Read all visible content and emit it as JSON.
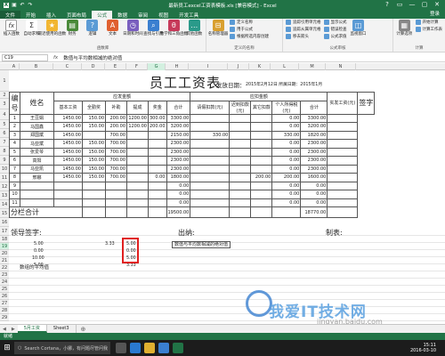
{
  "window": {
    "title": "最新员工excel工资表模板.xls [兼容模式] - Excel",
    "controls": [
      "?",
      "▭",
      "—",
      "▢",
      "✕"
    ]
  },
  "ribbon": {
    "tabs": [
      "文件",
      "开始",
      "插入",
      "页面布局",
      "公式",
      "数据",
      "审阅",
      "视图",
      "开发工具"
    ],
    "active_tab": "公式",
    "login": "登录",
    "groups": [
      {
        "name": "函数库",
        "buttons": [
          "插入函数",
          "自动求和",
          "最近使用的函数",
          "财务",
          "逻辑",
          "文本",
          "日期和时间",
          "查找与引用",
          "数学和三角函数",
          "其他函数"
        ]
      },
      {
        "name": "定义的名称",
        "buttons": [
          "名称管理器"
        ],
        "small": [
          "定义名称",
          "用于公式",
          "根据所选内容创建"
        ]
      },
      {
        "name": "公式审核",
        "small": [
          "追踪引用单元格",
          "追踪从属单元格",
          "移去箭头",
          "显示公式",
          "错误检查",
          "公式求值"
        ],
        "buttons": [
          "监视窗口"
        ]
      },
      {
        "name": "计算",
        "buttons": [
          "计算选项"
        ],
        "small": [
          "开始计算",
          "计算工作表"
        ]
      }
    ]
  },
  "formula_bar": {
    "name_box": "C19",
    "fx": "fx",
    "content": "数值与平均数相减的绝对值"
  },
  "columns": [
    "A",
    "B",
    "C",
    "D",
    "E",
    "F",
    "G",
    "H",
    "I",
    "J",
    "K",
    "L",
    "M",
    "N"
  ],
  "rows": [
    "1",
    "2",
    "3",
    "4",
    "5",
    "6",
    "7",
    "8",
    "9",
    "10",
    "11",
    "12",
    "13",
    "14",
    "15",
    "16",
    "17",
    "18",
    "19",
    "20",
    "21",
    "22",
    "23",
    "24",
    "25",
    "26",
    "27",
    "28",
    "29"
  ],
  "sheet": {
    "title": "员工工资表",
    "issue_label": "发放日期：",
    "issue_info": "2015年2月12日 所属日期：2015年1月",
    "header": {
      "no": "编号",
      "name": "姓名",
      "payable": "应发金额",
      "deduct": "应扣金额",
      "net": "实发工资(元)",
      "sign": "签字",
      "payable_cols": [
        "基本工资",
        "全勤奖",
        "补助",
        "提成",
        "奖金",
        "合计"
      ],
      "deduct_cols": [
        "请假扣款(元)",
        "迟到扣款(元)",
        "其它扣款",
        "个人所得税(元)",
        "合计"
      ]
    },
    "employees": [
      {
        "no": "1",
        "name": "王豆娟",
        "base": "1450.00",
        "full": "150.00",
        "sub": "200.00",
        "comm": "1200.00",
        "bonus": "300.00",
        "total": "3300.00",
        "leave": "",
        "late": "",
        "other": "",
        "tax": "",
        "dtotal": "0.00",
        "net": "3300.00"
      },
      {
        "no": "2",
        "name": "马国鑫",
        "base": "1450.00",
        "full": "150.00",
        "sub": "200.00",
        "comm": "1200.00",
        "bonus": "200.00",
        "total": "3200.00",
        "leave": "",
        "late": "",
        "other": "",
        "tax": "",
        "dtotal": "0.00",
        "net": "3200.00"
      },
      {
        "no": "3",
        "name": "郑国斌",
        "base": "1450.00",
        "full": "",
        "sub": "700.00",
        "comm": "",
        "bonus": "",
        "total": "2150.00",
        "leave": "330.00",
        "late": "",
        "other": "",
        "tax": "",
        "dtotal": "330.00",
        "net": "1820.00"
      },
      {
        "no": "4",
        "name": "马亚斌",
        "base": "1450.00",
        "full": "150.00",
        "sub": "700.00",
        "comm": "",
        "bonus": "",
        "total": "2300.00",
        "leave": "",
        "late": "",
        "other": "",
        "tax": "",
        "dtotal": "0.00",
        "net": "2300.00"
      },
      {
        "no": "5",
        "name": "张爱琴",
        "base": "1450.00",
        "full": "150.00",
        "sub": "700.00",
        "comm": "",
        "bonus": "",
        "total": "2300.00",
        "leave": "",
        "late": "",
        "other": "",
        "tax": "",
        "dtotal": "0.00",
        "net": "2300.00"
      },
      {
        "no": "6",
        "name": "高阳",
        "base": "1450.00",
        "full": "150.00",
        "sub": "700.00",
        "comm": "",
        "bonus": "",
        "total": "2300.00",
        "leave": "",
        "late": "",
        "other": "",
        "tax": "",
        "dtotal": "0.00",
        "net": "2300.00"
      },
      {
        "no": "7",
        "name": "马亚凯",
        "base": "1450.00",
        "full": "150.00",
        "sub": "700.00",
        "comm": "",
        "bonus": "",
        "total": "2300.00",
        "leave": "",
        "late": "",
        "other": "",
        "tax": "",
        "dtotal": "0.00",
        "net": "2300.00"
      },
      {
        "no": "8",
        "name": "邢娜",
        "base": "1450.00",
        "full": "150.00",
        "sub": "700.00",
        "comm": "",
        "bonus": "0.00",
        "total": "1800.00",
        "leave": "",
        "late": "",
        "other": "200.00",
        "tax": "",
        "dtotal": "200.00",
        "net": "1600.00"
      },
      {
        "no": "9",
        "name": "",
        "base": "",
        "full": "",
        "sub": "",
        "comm": "",
        "bonus": "",
        "total": "0.00",
        "leave": "",
        "late": "",
        "other": "",
        "tax": "",
        "dtotal": "0.00",
        "net": "0.00"
      },
      {
        "no": "10",
        "name": "",
        "base": "",
        "full": "",
        "sub": "",
        "comm": "",
        "bonus": "",
        "total": "0.00",
        "leave": "",
        "late": "",
        "other": "",
        "tax": "",
        "dtotal": "0.00",
        "net": "0.00"
      },
      {
        "no": "11",
        "name": "",
        "base": "",
        "full": "",
        "sub": "",
        "comm": "",
        "bonus": "",
        "total": "0.00",
        "leave": "",
        "late": "",
        "other": "",
        "tax": "",
        "dtotal": "0.00",
        "net": "0.00"
      }
    ],
    "subtotal_label": "分栏合计",
    "subtotal_total": "19500.00",
    "subtotal_net": "18770.00",
    "footer": {
      "leader": "领导签字:",
      "cashier": "出纳:",
      "maker": "制表:"
    },
    "calc": {
      "r19": [
        "5.00",
        "3.33",
        "5.00"
      ],
      "r20": [
        "0.00",
        "0.00"
      ],
      "r21": [
        "10.00",
        "5.00"
      ],
      "r22_label": "数组的平均值",
      "r22": [
        "5.00",
        "3.33"
      ],
      "note": "数值与平均数相减的绝对值"
    }
  },
  "sheet_tabs": [
    "5月工资",
    "Sheet3"
  ],
  "active_sheet": "5月工资",
  "status": "就绪",
  "taskbar": {
    "search": "Search Cortana，小娜，有问题尽管问我",
    "time": "15:11",
    "date": "2016-03-10"
  },
  "watermark": {
    "text": "我爱IT技术网",
    "url": "jingyan.baidu.com"
  }
}
